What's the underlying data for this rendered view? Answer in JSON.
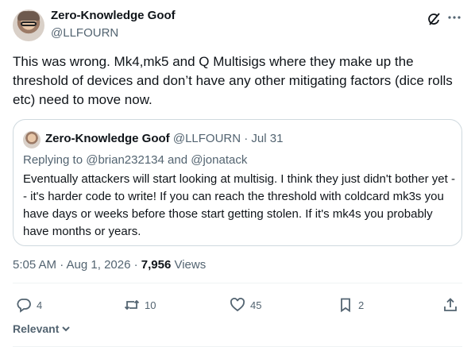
{
  "tweet": {
    "author_name": "Zero-Knowledge Goof",
    "author_handle": "@LLFOURN",
    "text": "This was wrong. Mk4,mk5 and Q Multisigs where they make up the threshold of devices and don’t have any other mitigating factors (dice rolls etc) need to move now.",
    "timestamp": "5:05 AM · Aug 1, 2026 · ",
    "views_count": "7,956",
    "views_label": " Views"
  },
  "quote": {
    "author_name": "Zero-Knowledge Goof",
    "author_meta": " @LLFOURN · Jul 31",
    "replying_prefix": "Replying to ",
    "reply_handle_1": "@brian232134",
    "reply_and": " and ",
    "reply_handle_2": "@jonatack",
    "text": "Eventually attackers will start looking at multisig. I think they just didn't bother yet -- it's harder code to write! If you can reach the threshold with coldcard mk3s you have days or weeks before those start getting stolen. If it's mk4s you probably have months or years."
  },
  "actions": {
    "reply_count": "4",
    "retweet_count": "10",
    "like_count": "45",
    "bookmark_count": "2"
  },
  "footer": {
    "relevant_label": "Relevant"
  },
  "icons": [
    "grok-icon",
    "more-icon",
    "reply-icon",
    "retweet-icon",
    "like-icon",
    "bookmark-icon",
    "share-icon",
    "chevron-down-icon"
  ],
  "colors": {
    "text_primary": "#0f1419",
    "text_secondary": "#536471",
    "border": "#cfd9de"
  }
}
